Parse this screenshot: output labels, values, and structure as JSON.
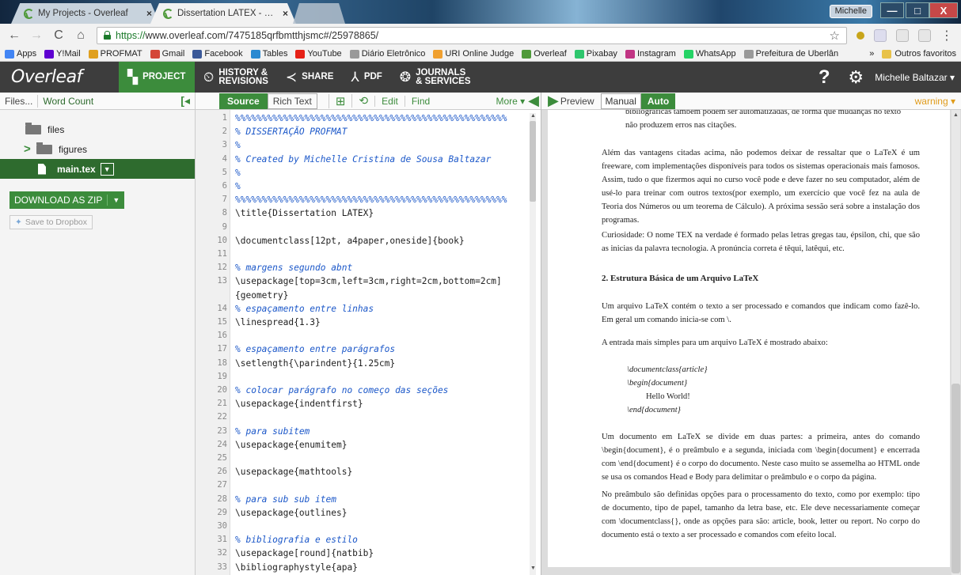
{
  "browser": {
    "tabs": [
      {
        "label": "My Projects - Overleaf",
        "close": "×"
      },
      {
        "label": "Dissertation LATEX - Ove",
        "close": "×"
      }
    ],
    "user_chip": "Michelle",
    "window_buttons": {
      "min": "—",
      "max": "□",
      "close": "X"
    },
    "url_protocol": "https://",
    "url_rest": "www.overleaf.com/7475185qrfbmtthjsmc#/25978865/",
    "bookmarks": [
      {
        "label": "Apps",
        "color": "#4285f4"
      },
      {
        "label": "Y!Mail",
        "color": "#5f01d1"
      },
      {
        "label": "PROFMAT",
        "color": "#e0a020"
      },
      {
        "label": "Gmail",
        "color": "#d44638"
      },
      {
        "label": "Facebook",
        "color": "#3b5998"
      },
      {
        "label": "Tables",
        "color": "#2b8ad1"
      },
      {
        "label": "YouTube",
        "color": "#e62117"
      },
      {
        "label": "Diário Eletrônico",
        "color": "#999999"
      },
      {
        "label": "URI Online Judge",
        "color": "#f0a030"
      },
      {
        "label": "Overleaf",
        "color": "#4f9a3a"
      },
      {
        "label": "Pixabay",
        "color": "#2ec66d"
      },
      {
        "label": "Instagram",
        "color": "#c13584"
      },
      {
        "label": "WhatsApp",
        "color": "#25d366"
      },
      {
        "label": "Prefeitura de Uberlân",
        "color": "#999999"
      }
    ],
    "bookmarks_more": "»",
    "bookmarks_other": "Outros favoritos"
  },
  "overleaf": {
    "logo": "Overleaf",
    "nav": {
      "project": "PROJECT",
      "history": "HISTORY &\nREVISIONS",
      "share": "SHARE",
      "pdf": "PDF",
      "journals": "JOURNALS\n& SERVICES"
    },
    "help": "?",
    "user": "Michelle Baltazar ▾"
  },
  "files": {
    "tab_files": "Files...",
    "tab_wordcount": "Word Count",
    "items": [
      {
        "name": "files"
      },
      {
        "name": "figures"
      },
      {
        "name": "main.tex"
      }
    ],
    "download": "DOWNLOAD AS ZIP",
    "dropbox": "Save to Dropbox"
  },
  "editor": {
    "source": "Source",
    "rich": "Rich Text",
    "edit": "Edit",
    "find": "Find",
    "more": "More ▾",
    "lines": [
      {
        "n": "1",
        "t": "%%%%%%%%%%%%%%%%%%%%%%%%%%%%%%%%%%%%%%%%%%%%%%%%%%%",
        "c": true
      },
      {
        "n": "2",
        "t": "% DISSERTAÇÃO PROFMAT",
        "c": true
      },
      {
        "n": "3",
        "t": "%",
        "c": true
      },
      {
        "n": "4",
        "t": "% Created by Michelle Cristina de Sousa Baltazar",
        "c": true
      },
      {
        "n": "5",
        "t": "%",
        "c": true
      },
      {
        "n": "6",
        "t": "%",
        "c": true
      },
      {
        "n": "7",
        "t": "%%%%%%%%%%%%%%%%%%%%%%%%%%%%%%%%%%%%%%%%%%%%%%%%%%%",
        "c": true
      },
      {
        "n": "8",
        "t": "\\title{Dissertation LATEX}",
        "c": false
      },
      {
        "n": "9",
        "t": "",
        "c": false
      },
      {
        "n": "10",
        "t": "\\documentclass[12pt, a4paper,oneside]{book}",
        "c": false
      },
      {
        "n": "11",
        "t": "",
        "c": false
      },
      {
        "n": "12",
        "t": "% margens segundo abnt",
        "c": true
      },
      {
        "n": "13",
        "t": "\\usepackage[top=3cm,left=3cm,right=2cm,bottom=2cm]",
        "c": false
      },
      {
        "n": "",
        "t": "{geometry}",
        "c": false
      },
      {
        "n": "14",
        "t": "% espaçamento entre linhas",
        "c": true
      },
      {
        "n": "15",
        "t": "\\linespread{1.3}",
        "c": false
      },
      {
        "n": "16",
        "t": "",
        "c": false
      },
      {
        "n": "17",
        "t": "% espaçamento entre parágrafos",
        "c": true
      },
      {
        "n": "18",
        "t": "\\setlength{\\parindent}{1.25cm}",
        "c": false
      },
      {
        "n": "19",
        "t": "",
        "c": false
      },
      {
        "n": "20",
        "t": "% colocar parágrafo no começo das seções",
        "c": true
      },
      {
        "n": "21",
        "t": "\\usepackage{indentfirst}",
        "c": false
      },
      {
        "n": "22",
        "t": "",
        "c": false
      },
      {
        "n": "23",
        "t": "% para subitem",
        "c": true
      },
      {
        "n": "24",
        "t": "\\usepackage{enumitem}",
        "c": false
      },
      {
        "n": "25",
        "t": "",
        "c": false
      },
      {
        "n": "26",
        "t": "\\usepackage{mathtools}",
        "c": false
      },
      {
        "n": "27",
        "t": "",
        "c": false
      },
      {
        "n": "28",
        "t": "% para sub sub item",
        "c": true
      },
      {
        "n": "29",
        "t": "\\usepackage{outlines}",
        "c": false
      },
      {
        "n": "30",
        "t": "",
        "c": false
      },
      {
        "n": "31",
        "t": "% bibliografia e estilo",
        "c": true
      },
      {
        "n": "32",
        "t": "\\usepackage[round]{natbib}",
        "c": false
      },
      {
        "n": "33",
        "t": "\\bibliographystyle{apa}",
        "c": false
      },
      {
        "n": "34",
        "t": "",
        "c": false
      }
    ]
  },
  "preview": {
    "label": "Preview",
    "manual": "Manual",
    "auto": "Auto",
    "warning": "warning ▾",
    "paragraphs": {
      "p0a": "bibliográficas também podem ser automatizadas, de forma que mudanças no texto",
      "p0b": "não produzem erros nas citações.",
      "p1": "Além das vantagens citadas acima, não podemos deixar de ressaltar que o LaTeX é um freeware, com implementações disponíveis para todos os sistemas operacionais mais famosos. Assim, tudo o que fizermos aqui no curso você pode e deve fazer no seu computador, além de usé-lo para treinar com outros textos(por exemplo, um exercício que você fez na aula de Teoria dos Números ou um teorema de Cálculo). A próxima sessão será sobre a instalação dos programas.",
      "p2": "Curiosidade: O nome TEX na verdade é formado pelas letras gregas tau, épsilon, chi, que são as inicias da palavra tecnologia. A pronúncia correta é têqui, latêqui, etc.",
      "h2": "2. Estrutura Básica de um Arquivo LaTeX",
      "p3": "Um arquivo LaTeX contém o texto a ser processado e comandos que indicam como fazê-lo. Em geral um comando inicia-se com \\.",
      "p4": "A entrada mais simples para um arquivo LaTeX é mostrado abaixo:",
      "code1": "\\documentclass{article}",
      "code2": "\\begin{document}",
      "code3": "Hello World!",
      "code4": "\\end{document}",
      "p5": "Um documento em LaTeX se divide em duas partes: a primeira, antes do comando \\begin{document}, é o preâmbulo e a segunda, iniciada com \\begin{document} e encerrada com \\end{document} é o corpo do documento. Neste caso muito se assemelha ao HTML onde se usa os comandos Head e Body para delimitar o preâmbulo e o corpo da página.",
      "p6": "No preâmbulo são definidas opções para o processamento do texto, como por exemplo: tipo de documento, tipo de papel, tamanho da letra base, etc. Ele deve necessariamente começar com \\documentclass{}, onde as opções para são: article, book, letter ou report. No corpo do documento está o texto a ser processado e comandos com efeito local."
    }
  }
}
